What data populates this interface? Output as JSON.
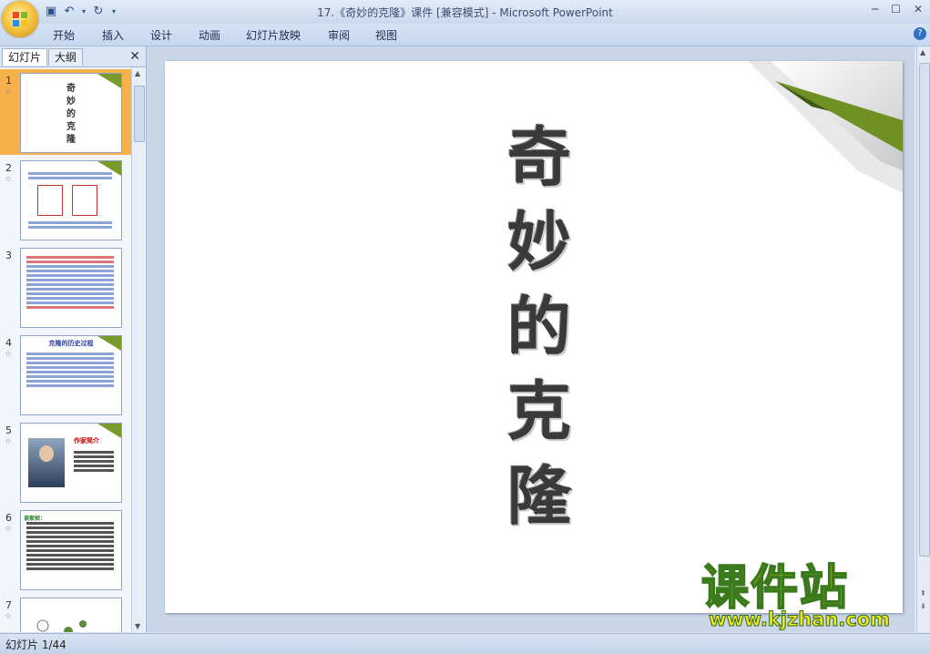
{
  "window": {
    "title": "17.《奇妙的克隆》课件 [兼容模式] - Microsoft PowerPoint",
    "controls": [
      "─",
      "☐",
      "✕"
    ]
  },
  "qat": {
    "save_icon": "save-icon",
    "undo_icon": "undo-icon",
    "redo_icon": "redo-icon",
    "customize_icon": "customize-icon"
  },
  "ribbon": {
    "tabs": [
      "开始",
      "插入",
      "设计",
      "动画",
      "幻灯片放映",
      "审阅",
      "视图"
    ],
    "help": "?"
  },
  "pane": {
    "tabs": [
      "幻灯片",
      "大纲"
    ],
    "close": "✕",
    "thumbnails": [
      {
        "num": "1",
        "star": "☆",
        "lines": [
          "奇",
          "妙",
          "的",
          "克",
          "隆"
        ]
      },
      {
        "num": "2",
        "star": "☆"
      },
      {
        "num": "3",
        "star": ""
      },
      {
        "num": "4",
        "star": "☆",
        "heading": "克隆的历史过程"
      },
      {
        "num": "5",
        "star": "☆",
        "heading": "作家简介"
      },
      {
        "num": "6",
        "star": "☆",
        "heading": "谈家桢："
      },
      {
        "num": "7",
        "star": "☆"
      }
    ]
  },
  "slide": {
    "title_chars": [
      "奇",
      "妙",
      "的",
      "克",
      "隆"
    ]
  },
  "status": {
    "slide_counter": "幻灯片 1/44"
  },
  "watermark": {
    "cn": "课件站",
    "url": "www.kjzhan.com"
  }
}
